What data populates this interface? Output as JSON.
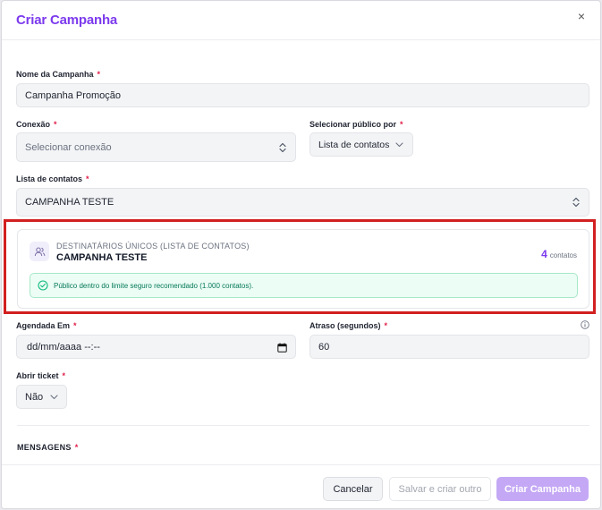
{
  "modal": {
    "title": "Criar Campanha",
    "close_glyph": "×"
  },
  "form": {
    "campaign_name": {
      "label": "Nome da Campanha",
      "required_mark": "*",
      "value": "Campanha Promoção"
    },
    "connection": {
      "label": "Conexão",
      "required_mark": "*",
      "placeholder": "Selecionar conexão"
    },
    "audience_by": {
      "label": "Selecionar público por",
      "required_mark": "*",
      "value": "Lista de contatos"
    },
    "contact_list": {
      "label": "Lista de contatos",
      "required_mark": "*",
      "value": "CAMPANHA TESTE"
    },
    "scheduled_at": {
      "label": "Agendada Em",
      "required_mark": "*",
      "value": "dd/mm/aaaa --:--"
    },
    "delay": {
      "label": "Atraso (segundos)",
      "required_mark": "*",
      "value": "60"
    },
    "open_ticket": {
      "label": "Abrir ticket",
      "required_mark": "*",
      "value": "Não"
    }
  },
  "recipients": {
    "subtitle": "DESTINATÁRIOS ÚNICOS (LISTA DE CONTATOS)",
    "list_name": "CAMPANHA TESTE",
    "count": "4",
    "count_unit": "contatos",
    "notice": "Público dentro do limite seguro recomendado (1.000 contatos)."
  },
  "messages": {
    "title": "MENSAGENS",
    "required_mark": "*"
  },
  "footer": {
    "cancel_label": "Cancelar",
    "save_new_label": "Salvar e criar outro",
    "create_label": "Criar Campanha"
  },
  "colors": {
    "accent": "#7c3aed",
    "required": "#e11d48",
    "notice_bg": "#ecfdf5",
    "notice_text": "#047857",
    "highlight": "#d21f1f"
  },
  "icons": {
    "close": "close-icon",
    "select_updown": "chevron-updown-icon",
    "dropdown": "chevron-down-icon",
    "users": "users-icon",
    "check": "check-circle-icon",
    "calendar": "calendar-icon",
    "info": "info-icon"
  }
}
